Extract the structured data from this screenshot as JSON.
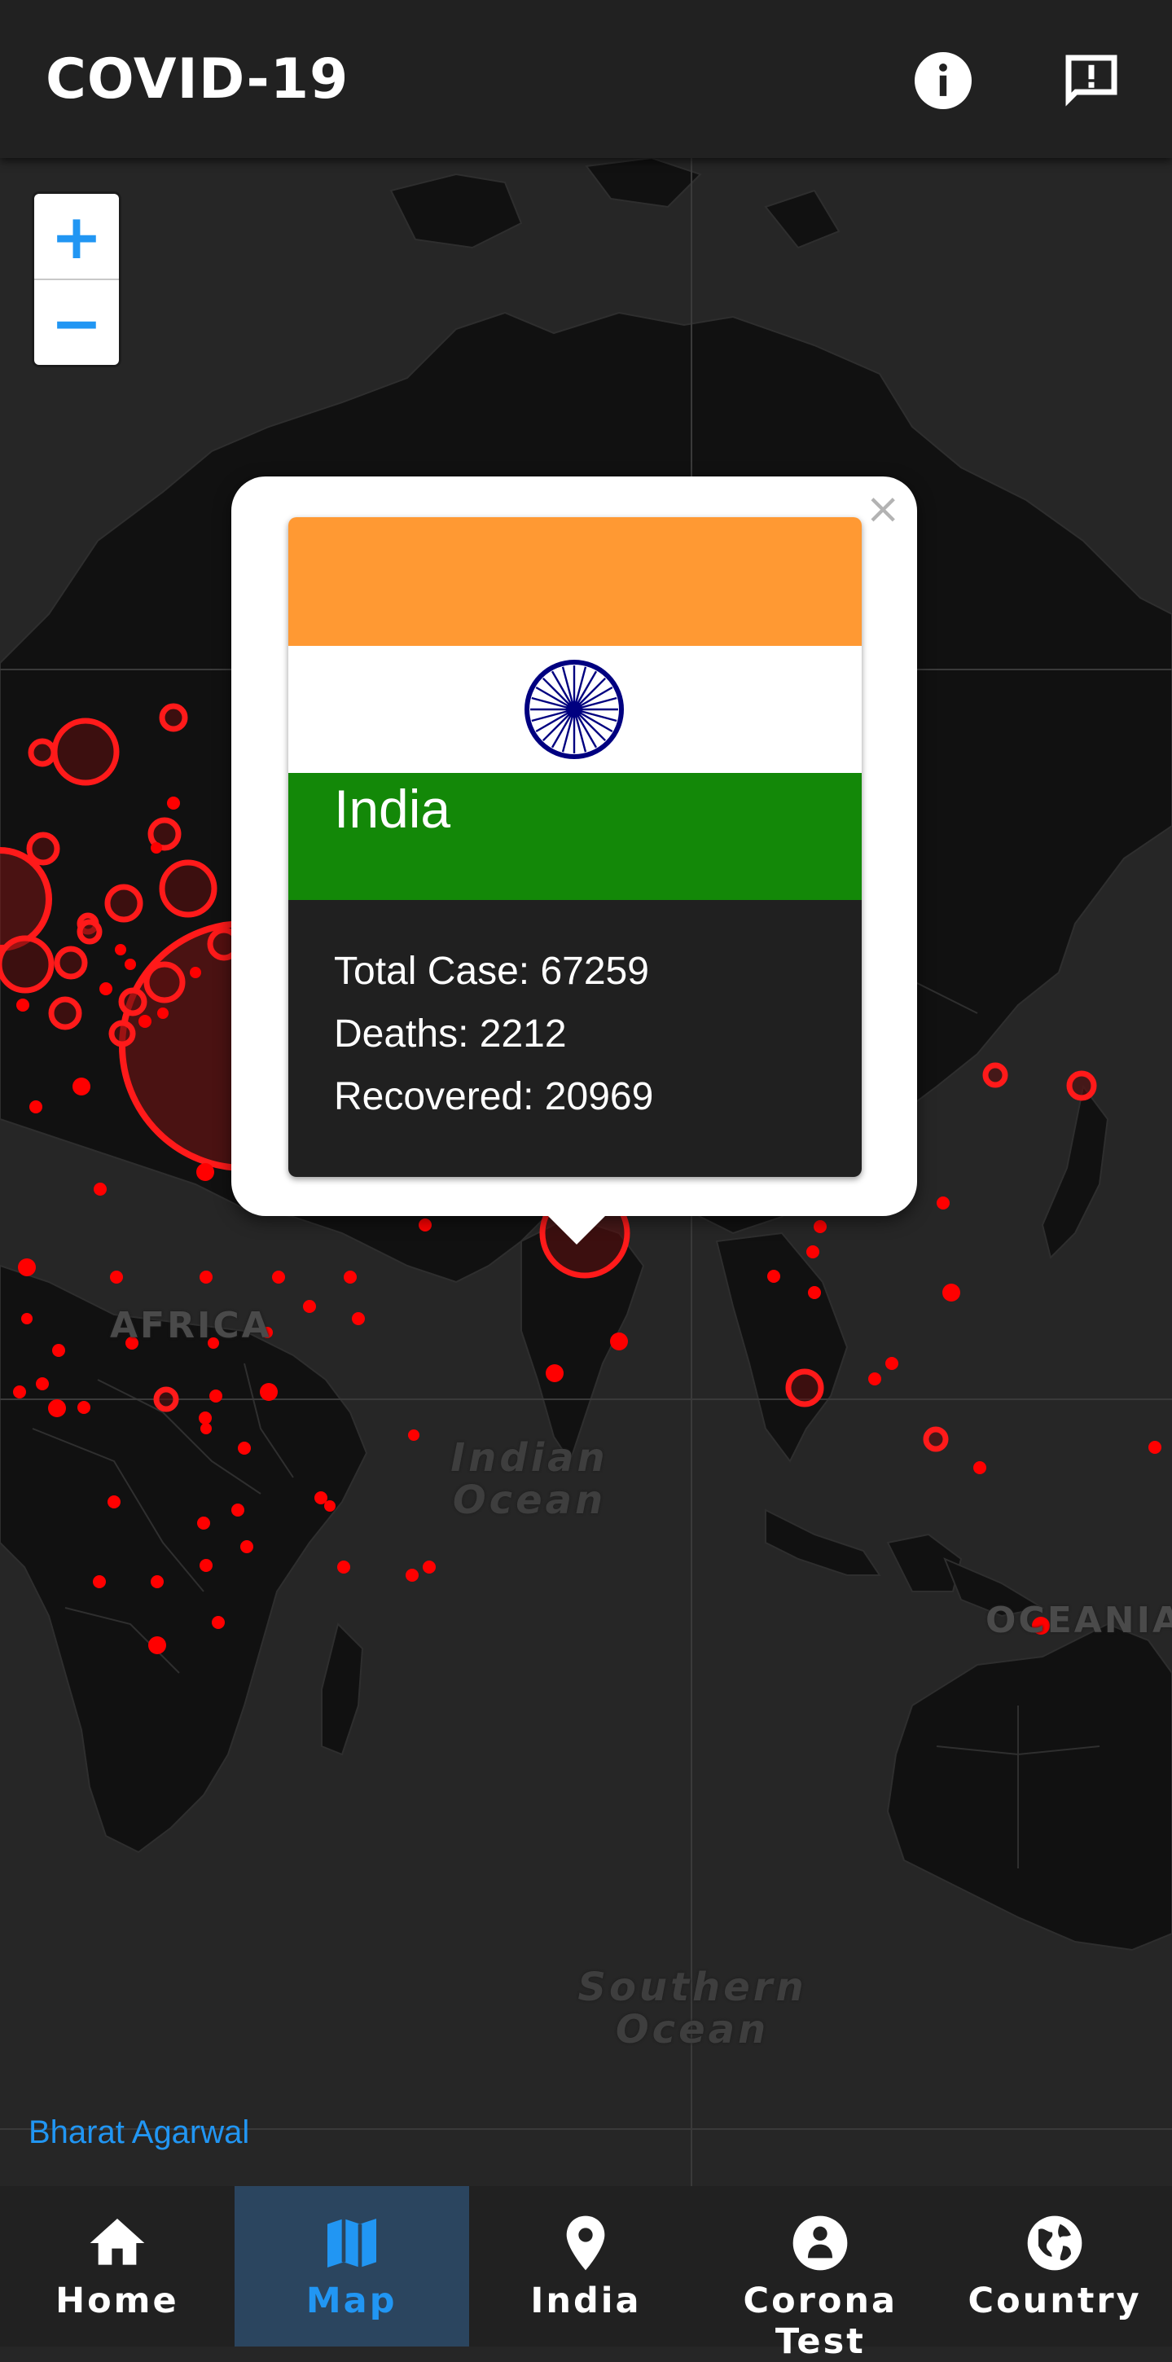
{
  "appbar": {
    "title": "COVID-19",
    "info_icon": "info-icon",
    "feedback_icon": "feedback-icon"
  },
  "map": {
    "labels": {
      "africa": "AFRICA",
      "oceania": "OCEANIA",
      "indian_ocean": "Indian Ocean",
      "southern_ocean": "Southern Ocean"
    },
    "zoom_in_label": "+",
    "zoom_out_label": "−",
    "attribution": "Bharat Agarwal",
    "marker_color": "#ff0000"
  },
  "popup": {
    "close_label": "×",
    "country": "India",
    "flag_colors": {
      "saffron": "#ff9933",
      "white": "#ffffff",
      "green": "#138808",
      "chakra": "#000080"
    },
    "stats": [
      {
        "label": "Total Case: 67259"
      },
      {
        "label": "Deaths: 2212"
      },
      {
        "label": "Recovered: 20969"
      }
    ]
  },
  "bottom_nav": {
    "items": [
      {
        "label": "Home",
        "icon": "home-icon",
        "active": false
      },
      {
        "label": "Map",
        "icon": "map-icon",
        "active": true
      },
      {
        "label": "India",
        "icon": "location-pin-icon",
        "active": false
      },
      {
        "label": "Corona Test",
        "icon": "test-person-icon",
        "active": false
      },
      {
        "label": "Country",
        "icon": "globe-icon",
        "active": false
      }
    ],
    "active_color": "#2196f3"
  }
}
